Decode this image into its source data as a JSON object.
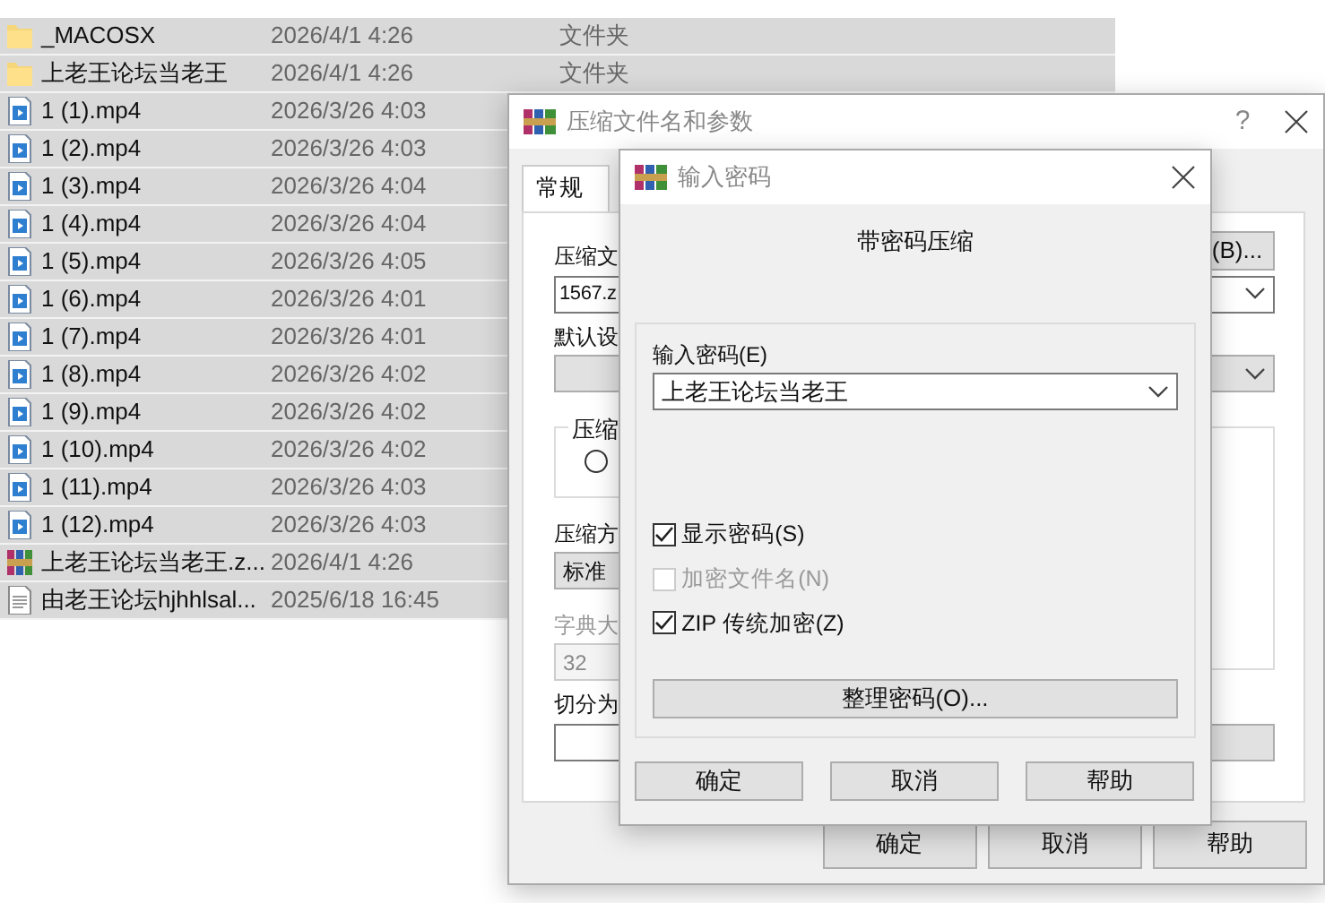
{
  "file_list": {
    "rows": [
      {
        "kind": "folder",
        "name": "_MACOSX",
        "modified": "2026/4/1 4:26",
        "type": "文件夹",
        "selected": true
      },
      {
        "kind": "folder",
        "name": "上老王论坛当老王",
        "modified": "2026/4/1 4:26",
        "type": "文件夹",
        "selected": true
      },
      {
        "kind": "video",
        "name": "1 (1).mp4",
        "modified": "2026/3/26 4:03",
        "selected": true
      },
      {
        "kind": "video",
        "name": "1 (2).mp4",
        "modified": "2026/3/26 4:03",
        "selected": true
      },
      {
        "kind": "video",
        "name": "1 (3).mp4",
        "modified": "2026/3/26 4:04",
        "selected": true
      },
      {
        "kind": "video",
        "name": "1 (4).mp4",
        "modified": "2026/3/26 4:04",
        "selected": true
      },
      {
        "kind": "video",
        "name": "1 (5).mp4",
        "modified": "2026/3/26 4:05",
        "selected": true
      },
      {
        "kind": "video",
        "name": "1 (6).mp4",
        "modified": "2026/3/26 4:01",
        "selected": true
      },
      {
        "kind": "video",
        "name": "1 (7).mp4",
        "modified": "2026/3/26 4:01",
        "selected": true
      },
      {
        "kind": "video",
        "name": "1 (8).mp4",
        "modified": "2026/3/26 4:02",
        "selected": true
      },
      {
        "kind": "video",
        "name": "1 (9).mp4",
        "modified": "2026/3/26 4:02",
        "selected": true
      },
      {
        "kind": "video",
        "name": "1 (10).mp4",
        "modified": "2026/3/26 4:02",
        "selected": true
      },
      {
        "kind": "video",
        "name": "1 (11).mp4",
        "modified": "2026/3/26 4:03",
        "selected": true
      },
      {
        "kind": "video",
        "name": "1 (12).mp4",
        "modified": "2026/3/26 4:03",
        "selected": true
      },
      {
        "kind": "archive",
        "name": "上老王论坛当老王.z...",
        "modified": "2026/4/1 4:26",
        "selected": true
      },
      {
        "kind": "text",
        "name": "由老王论坛hjhhlsal...",
        "modified": "2025/6/18 16:45",
        "selected": true
      }
    ]
  },
  "compress_dialog": {
    "title": "压缩文件名和参数",
    "help": "?",
    "tabs": [
      {
        "label": "常规",
        "selected": true
      }
    ],
    "archive_name_label": "压缩文",
    "browse_button": "(B)...",
    "archive_name_value": "1567.z",
    "profile_label": "默认设",
    "format_group_label": "压缩",
    "format_radio": {
      "selected": false
    },
    "method_label": "压缩方",
    "method_value": "标准",
    "dictionary": {
      "label": "字典大",
      "value": "32",
      "disabled": true
    },
    "split_label": "切分为",
    "buttons": [
      "确定",
      "取消",
      "帮助"
    ]
  },
  "password_dialog": {
    "title": "输入密码",
    "heading": "带密码压缩",
    "password_label": "输入密码(E)",
    "password_value": "上老王论坛当老王",
    "options": [
      {
        "label": "显示密码(S)",
        "checked": true,
        "disabled": false
      },
      {
        "label": "加密文件名(N)",
        "checked": false,
        "disabled": true
      },
      {
        "label": "ZIP 传统加密(Z)",
        "checked": true,
        "disabled": false
      }
    ],
    "organize_button": "整理密码(O)...",
    "buttons": [
      "确定",
      "取消",
      "帮助"
    ]
  }
}
